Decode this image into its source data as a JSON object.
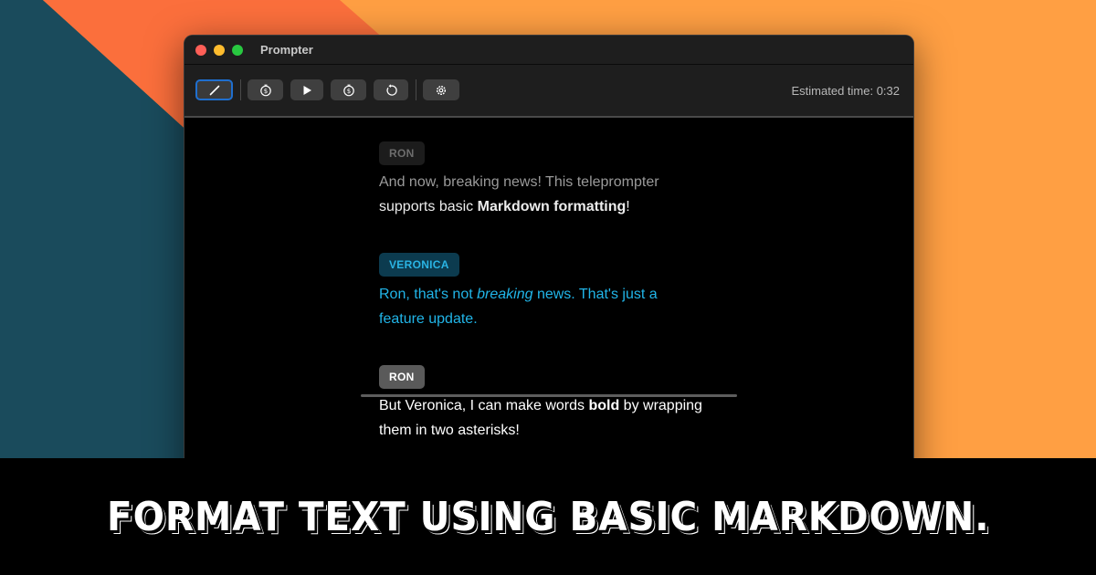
{
  "window": {
    "title": "Prompter"
  },
  "toolbar": {
    "buttons": [
      {
        "icon": "pencil-icon",
        "active": true
      },
      {
        "icon": "timer-dollar-icon"
      },
      {
        "icon": "play-icon"
      },
      {
        "icon": "timer-dollar-icon"
      },
      {
        "icon": "reset-icon"
      },
      {
        "icon": "gear-icon"
      }
    ],
    "estimated_time": "Estimated time: 0:32"
  },
  "script": [
    {
      "speaker": "RON",
      "line1_pre": "And now, breaking news! This teleprompter",
      "line2_pre": "supports basic ",
      "line2_bold": "Markdown formatting",
      "line2_post": "!"
    },
    {
      "speaker": "VERONICA",
      "line1_pre": "Ron, that's not ",
      "line1_italic": "breaking",
      "line1_post": " news. That's just a",
      "line2": "feature update."
    },
    {
      "speaker": "RON",
      "line1_pre": "But Veronica, I can make words ",
      "line1_bold": "bold",
      "line1_post": " by wrapping",
      "line2": "them in two asterisks!"
    }
  ],
  "banner": {
    "text": "Format text using basic Markdown."
  },
  "colors": {
    "accent_blue": "#21b5e8",
    "active_border": "#1f6fcf",
    "bg_orange": "#ff9f43",
    "bg_teal": "#1a4b5c"
  }
}
